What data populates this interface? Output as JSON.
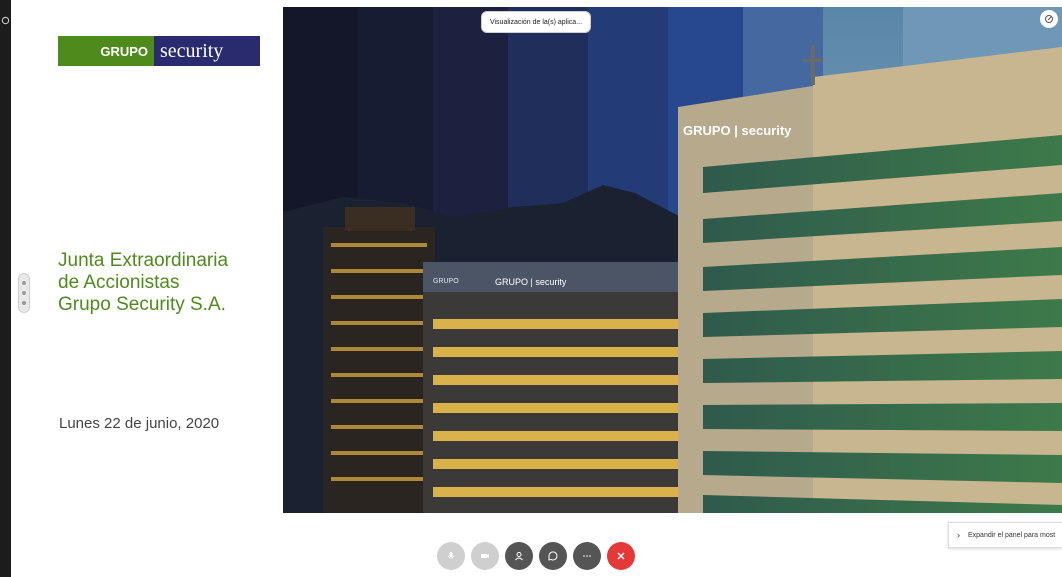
{
  "slide": {
    "logo": {
      "word1": "GRUPO",
      "word2": "security"
    },
    "title_lines": [
      "Junta Extraordinaria",
      "de Accionistas",
      "Grupo Security S.A."
    ],
    "date": "Lunes 22 de junio, 2020",
    "photo": {
      "sign_left_building": "GRUPO | security",
      "sign_right_building": "GRUPO | security",
      "sign_small": "GRUPO"
    }
  },
  "meeting": {
    "banner": "Visualización de la(s) aplica...",
    "expand_panel": "Expandir el panel para most",
    "controls": [
      {
        "name": "mic-icon"
      },
      {
        "name": "camera-icon"
      },
      {
        "name": "participants-icon"
      },
      {
        "name": "chat-icon"
      },
      {
        "name": "more-icon"
      },
      {
        "name": "hang-up-icon"
      }
    ]
  },
  "colors": {
    "brand_green": "#4f8a1c",
    "brand_navy": "#2a2a6e",
    "hangup_red": "#e53838"
  }
}
